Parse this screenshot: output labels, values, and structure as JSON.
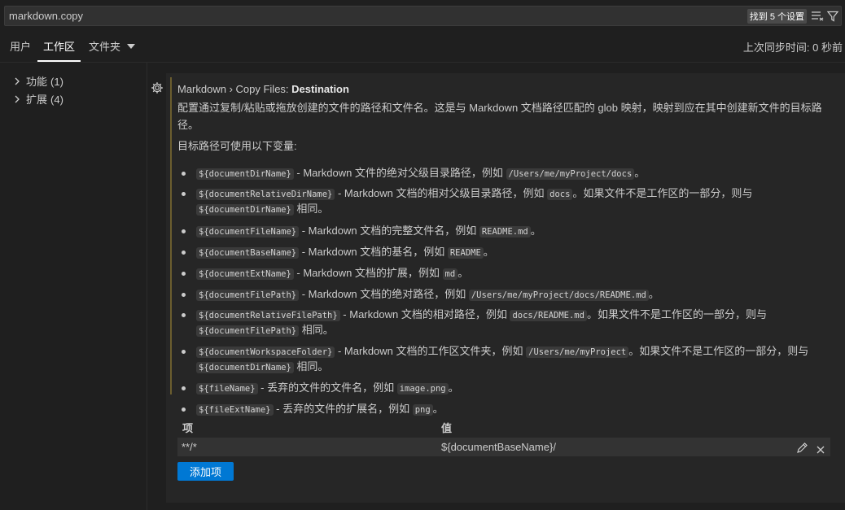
{
  "search": {
    "value": "markdown.copy",
    "result_badge": "找到 5 个设置"
  },
  "tabs": [
    {
      "label": "用户"
    },
    {
      "label": "工作区"
    },
    {
      "label": "文件夹"
    }
  ],
  "sync_status": "上次同步时间: 0 秒前",
  "toc": [
    {
      "label": "功能",
      "count": "(1)"
    },
    {
      "label": "扩展",
      "count": "(4)"
    }
  ],
  "setting": {
    "breadcrumb": "Markdown › Copy Files: ",
    "name": "Destination",
    "description": "配置通过复制/粘贴或拖放创建的文件的路径和文件名。这是与 Markdown 文档路径匹配的 glob 映射，映射到应在其中创建新文件的目标路径。",
    "vars_intro": "目标路径可使用以下变量:",
    "variables": [
      {
        "code": "${documentDirName}",
        "text": " - Markdown 文件的绝对父级目录路径，例如 ",
        "example": "/Users/me/myProject/docs",
        "tail": "。"
      },
      {
        "code": "${documentRelativeDirName}",
        "text": " - Markdown 文档的相对父级目录路径，例如 ",
        "example": "docs",
        "tail": "。如果文件不是工作区的一部分，则与 ",
        "code2": "${documentDirName}",
        "tail2": " 相同。"
      },
      {
        "code": "${documentFileName}",
        "text": " - Markdown 文档的完整文件名，例如 ",
        "example": "README.md",
        "tail": "。"
      },
      {
        "code": "${documentBaseName}",
        "text": " - Markdown 文档的基名，例如 ",
        "example": "README",
        "tail": "。"
      },
      {
        "code": "${documentExtName}",
        "text": " - Markdown 文档的扩展，例如 ",
        "example": "md",
        "tail": "。"
      },
      {
        "code": "${documentFilePath}",
        "text": " - Markdown 文档的绝对路径，例如 ",
        "example": "/Users/me/myProject/docs/README.md",
        "tail": "。"
      },
      {
        "code": "${documentRelativeFilePath}",
        "text": " - Markdown 文档的相对路径，例如 ",
        "example": "docs/README.md",
        "tail": "。如果文件不是工作区的一部分，则与 ",
        "code2": "${documentFilePath}",
        "tail2": " 相同。"
      },
      {
        "code": "${documentWorkspaceFolder}",
        "text": " - Markdown 文档的工作区文件夹，例如 ",
        "example": "/Users/me/myProject",
        "tail": "。如果文件不是工作区的一部分，则与 ",
        "code2": "${documentDirName}",
        "tail2": " 相同。"
      },
      {
        "code": "${fileName}",
        "text": " - 丢弃的文件的文件名，例如 ",
        "example": "image.png",
        "tail": "。"
      },
      {
        "code": "${fileExtName}",
        "text": " - 丢弃的文件的扩展名，例如 ",
        "example": "png",
        "tail": "。"
      }
    ],
    "table": {
      "headers": {
        "item": "项",
        "value": "值"
      },
      "rows": [
        {
          "item": "**/*",
          "value": "${documentBaseName}/"
        }
      ]
    },
    "add_button": "添加项"
  },
  "colors": {
    "accent": "#0078d4",
    "background": "#1f1f1f",
    "panel": "#262626"
  },
  "icons": [
    "clear-filter-icon",
    "filter-icon",
    "chevron-down-icon",
    "chevron-right-icon",
    "gear-icon",
    "edit-icon",
    "remove-icon"
  ]
}
